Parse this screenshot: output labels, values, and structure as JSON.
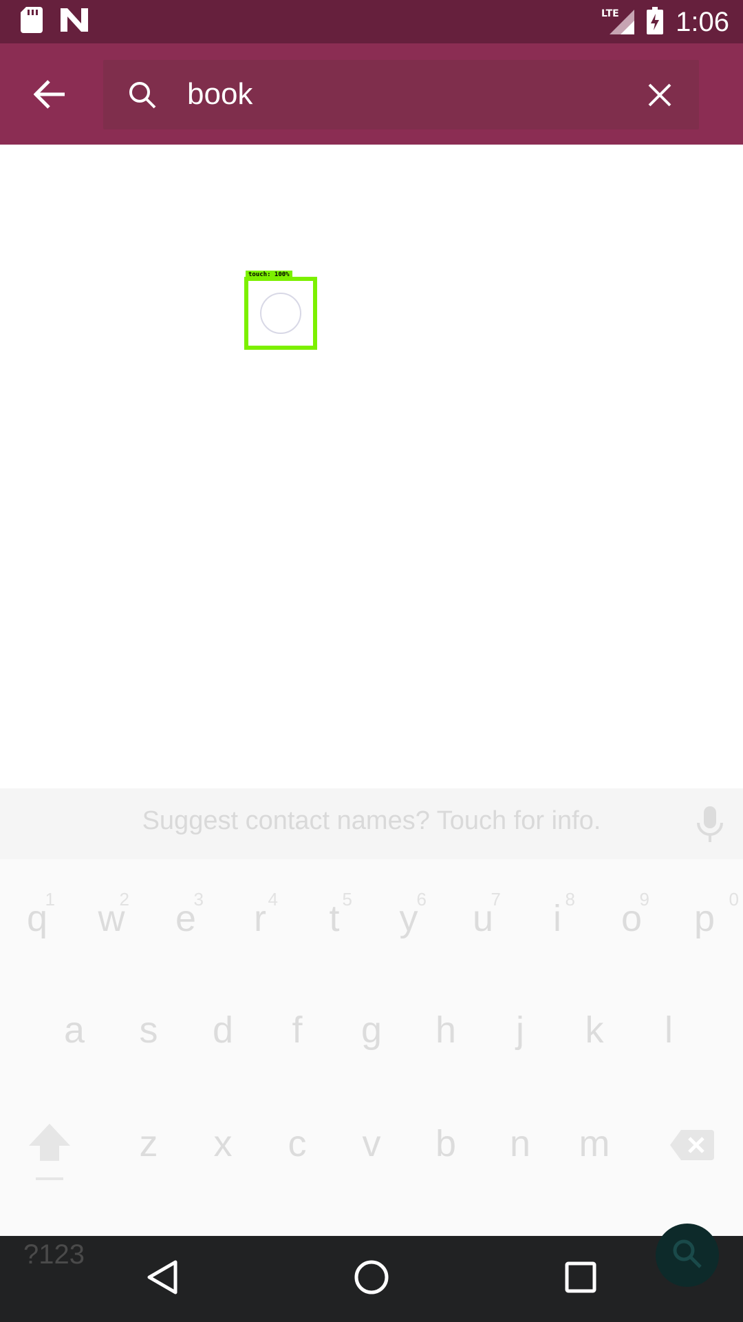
{
  "status_bar": {
    "time": "1:06",
    "network": "LTE",
    "icons": [
      "sd-card-icon",
      "n-notification-icon",
      "lte-signal-icon",
      "battery-charging-icon"
    ]
  },
  "toolbar": {
    "search_query": "book",
    "icons": [
      "back-arrow-icon",
      "search-icon",
      "close-icon"
    ]
  },
  "overlay": {
    "label": "touch: 100%"
  },
  "keyboard": {
    "suggestion": "Suggest contact names? Touch for info.",
    "row1": [
      {
        "key": "q",
        "hint": "1"
      },
      {
        "key": "w",
        "hint": "2"
      },
      {
        "key": "e",
        "hint": "3"
      },
      {
        "key": "r",
        "hint": "4"
      },
      {
        "key": "t",
        "hint": "5"
      },
      {
        "key": "y",
        "hint": "6"
      },
      {
        "key": "u",
        "hint": "7"
      },
      {
        "key": "i",
        "hint": "8"
      },
      {
        "key": "o",
        "hint": "9"
      },
      {
        "key": "p",
        "hint": "0"
      }
    ],
    "row2": [
      "a",
      "s",
      "d",
      "f",
      "g",
      "h",
      "j",
      "k",
      "l"
    ],
    "row3": [
      "z",
      "x",
      "c",
      "v",
      "b",
      "n",
      "m"
    ],
    "symbols_label": "?123",
    "icons": [
      "microphone-icon",
      "shift-icon",
      "backspace-icon",
      "search-action-icon"
    ]
  },
  "nav_bar": {
    "icons": [
      "back-triangle-icon",
      "home-circle-icon",
      "recents-square-icon"
    ]
  }
}
